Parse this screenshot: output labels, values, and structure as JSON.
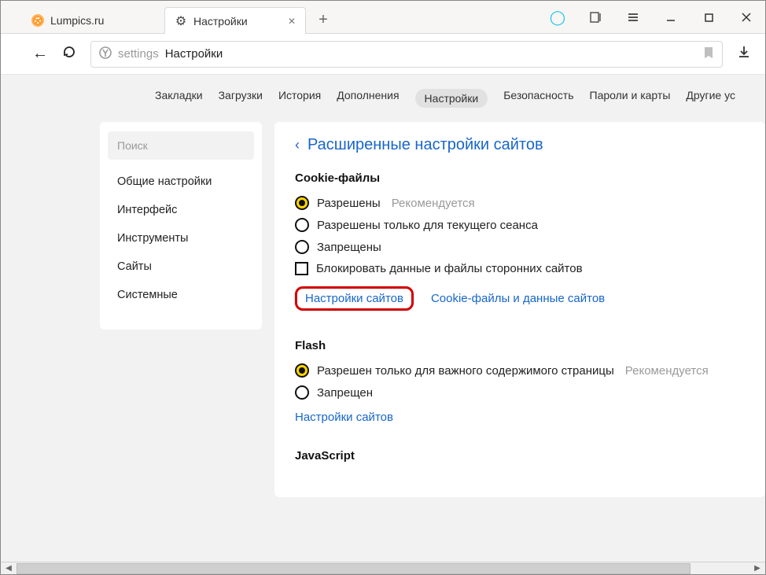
{
  "tabs": {
    "t0": {
      "title": "Lumpics.ru"
    },
    "t1": {
      "title": "Настройки"
    }
  },
  "addressbar": {
    "prefix": "settings",
    "title": "Настройки"
  },
  "topnav": {
    "n0": "Закладки",
    "n1": "Загрузки",
    "n2": "История",
    "n3": "Дополнения",
    "n4": "Настройки",
    "n5": "Безопасность",
    "n6": "Пароли и карты",
    "n7": "Другие ус"
  },
  "sidebar": {
    "search_placeholder": "Поиск",
    "i0": "Общие настройки",
    "i1": "Интерфейс",
    "i2": "Инструменты",
    "i3": "Сайты",
    "i4": "Системные"
  },
  "panel": {
    "title": "Расширенные настройки сайтов",
    "cookies": {
      "header": "Cookie-файлы",
      "o0": "Разрешены",
      "o0_hint": "Рекомендуется",
      "o1": "Разрешены только для текущего сеанса",
      "o2": "Запрещены",
      "chk": "Блокировать данные и файлы сторонних сайтов",
      "link0": "Настройки сайтов",
      "link1": "Cookie-файлы и данные сайтов"
    },
    "flash": {
      "header": "Flash",
      "o0": "Разрешен только для важного содержимого страницы",
      "o0_hint": "Рекомендуется",
      "o1": "Запрещен",
      "link0": "Настройки сайтов"
    },
    "js": {
      "header": "JavaScript"
    }
  }
}
